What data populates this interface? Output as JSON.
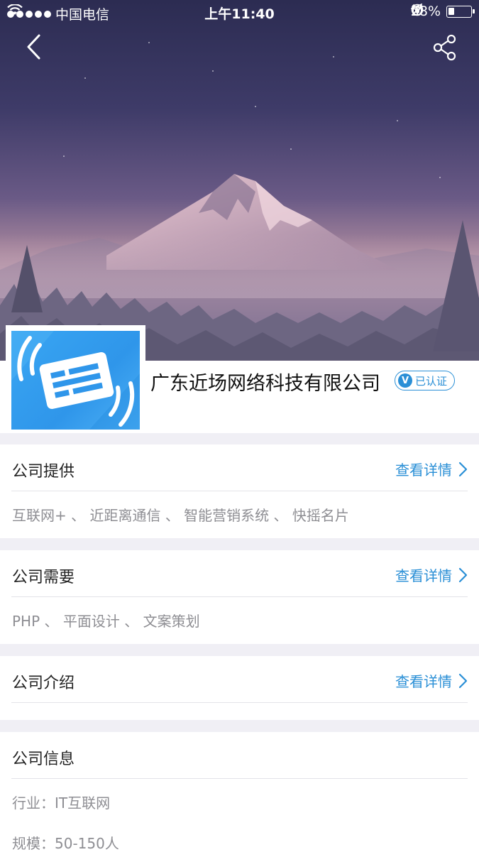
{
  "status_bar": {
    "carrier": "中国电信",
    "time": "上午11:40",
    "battery": "28%",
    "battery_level": 0.28
  },
  "nav": {
    "back_icon": "chevron-left-icon",
    "share_icon": "share-icon"
  },
  "company": {
    "name": "广东近场网络科技有限公司",
    "verified_label": "已认证",
    "verified_mark": "V"
  },
  "sections": {
    "provides": {
      "title": "公司提供",
      "link": "查看详情",
      "tags": "互联网+ 、 近距离通信 、 智能营销系统 、 快摇名片"
    },
    "needs": {
      "title": "公司需要",
      "link": "查看详情",
      "tags": "PHP 、 平面设计 、 文案策划"
    },
    "intro": {
      "title": "公司介绍",
      "link": "查看详情"
    },
    "info": {
      "title": "公司信息",
      "industry": "行业：IT互联网",
      "scale": "规模：50-150人"
    }
  },
  "colors": {
    "accent": "#2a8fd6",
    "page_bg": "#f0eff5",
    "muted_text": "#8e8e93"
  }
}
